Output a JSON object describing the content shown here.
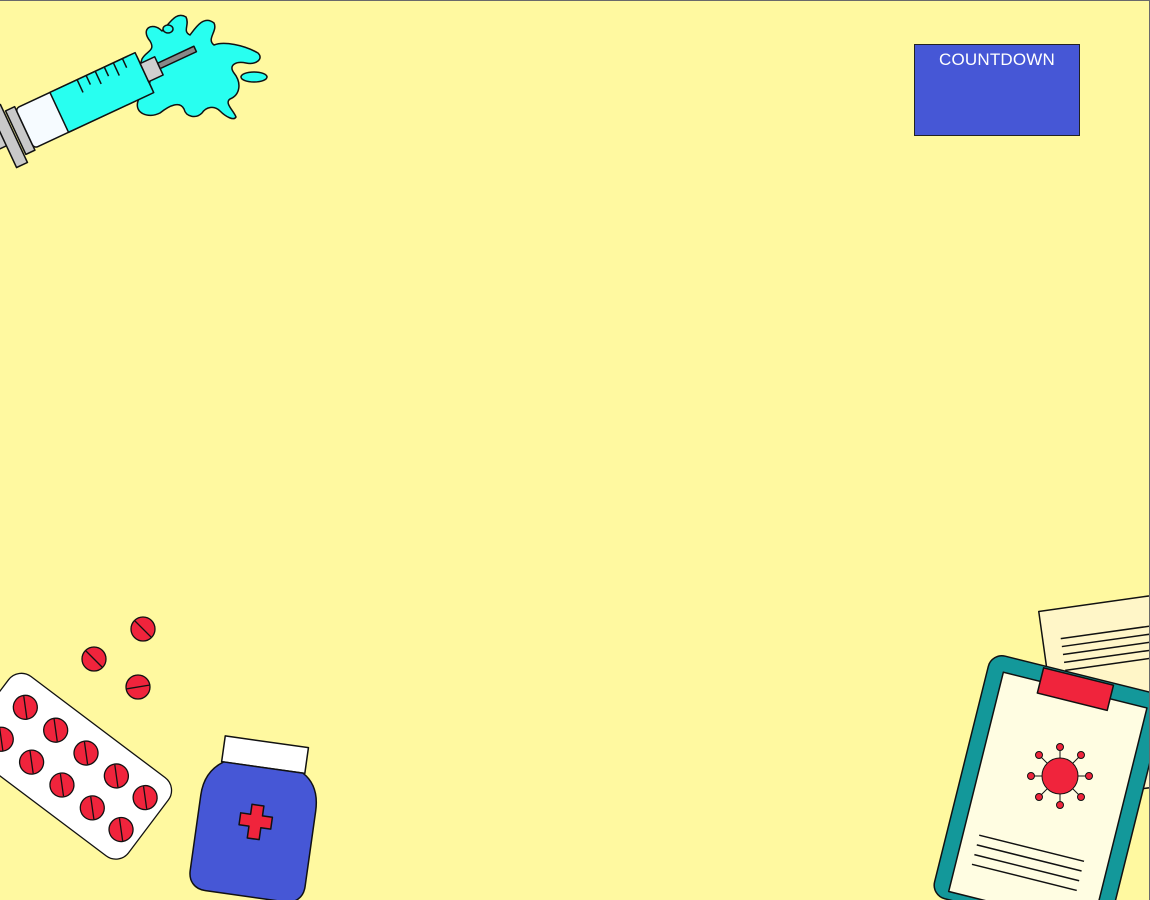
{
  "countdown": {
    "label": "COUNTDOWN"
  },
  "decorations": {
    "syringe": "syringe-icon",
    "pill_blister": "pill-blister-icon",
    "loose_pills": "pill-icon",
    "medicine_bottle": "medicine-bottle-icon",
    "clipboard": "clipboard-icon",
    "virus": "virus-icon"
  },
  "colors": {
    "background": "#fff9a0",
    "countdown_bg": "#4657d6",
    "pill_red": "#f0243c",
    "bottle_blue": "#4657d6",
    "syringe_cyan": "#28fff0",
    "clipboard_teal": "#13989a"
  }
}
